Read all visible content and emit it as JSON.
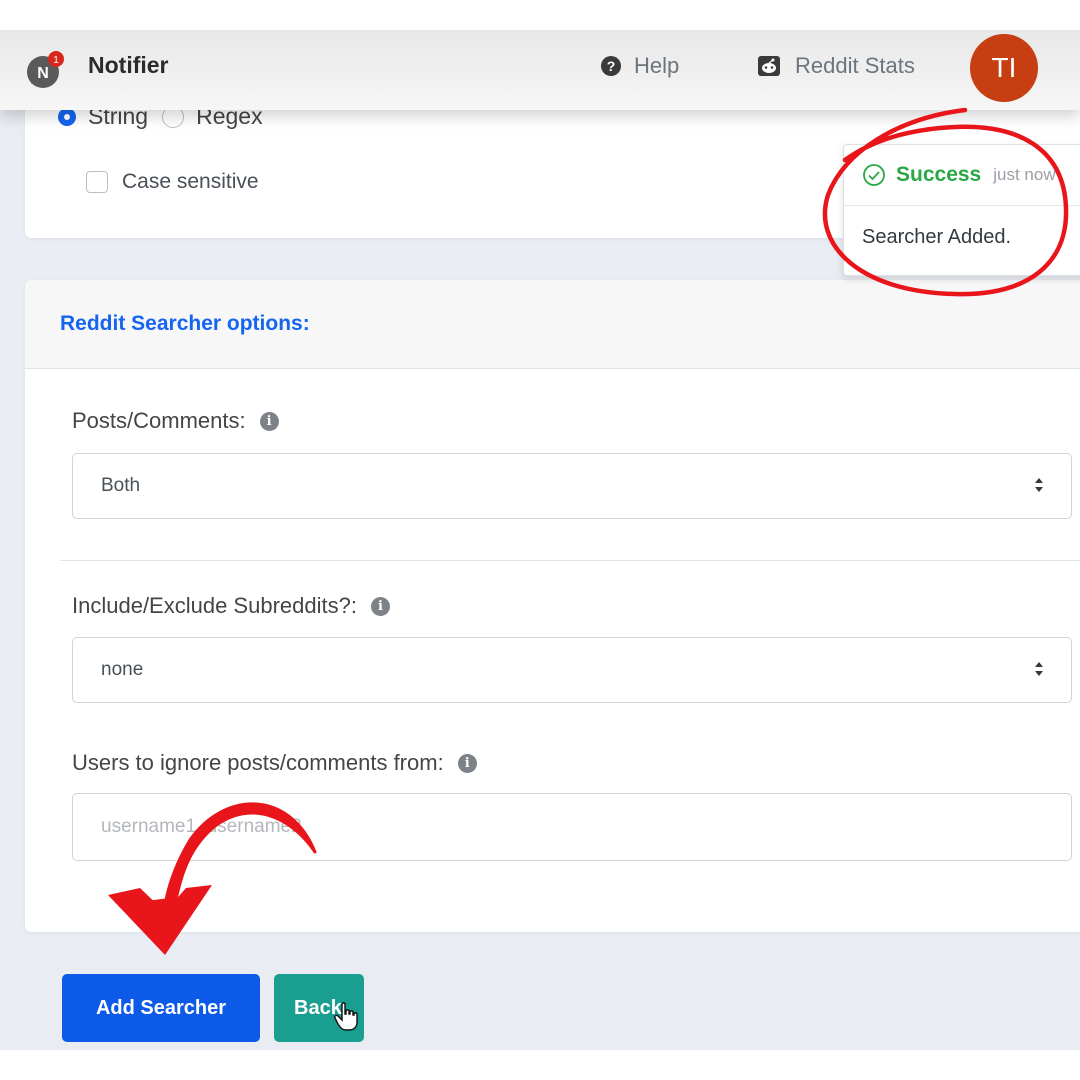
{
  "navbar": {
    "badge_count": "1",
    "logo_letter": "N",
    "brand": "Notifier",
    "help_label": "Help",
    "stats_label": "Reddit Stats",
    "avatar_initials": "TI"
  },
  "match_type": {
    "option_string": "String",
    "option_regex": "Regex",
    "selected": "String"
  },
  "case_sensitive": {
    "label": "Case sensitive",
    "checked": false
  },
  "toast": {
    "title": "Success",
    "time": "just now",
    "message": "Searcher Added."
  },
  "options_card": {
    "header": "Reddit Searcher options:",
    "posts_comments": {
      "label": "Posts/Comments:",
      "value": "Both"
    },
    "subreddits": {
      "label": "Include/Exclude Subreddits?:",
      "value": "none"
    },
    "ignore_users": {
      "label": "Users to ignore posts/comments from:",
      "placeholder": "username1, username2"
    }
  },
  "buttons": {
    "add_searcher": "Add Searcher",
    "back": "Back"
  },
  "colors": {
    "primary": "#0d59e8",
    "back_button": "#1a9e8f",
    "success": "#28a745",
    "annotation_red": "#e8151b",
    "avatar": "#c63e12"
  }
}
